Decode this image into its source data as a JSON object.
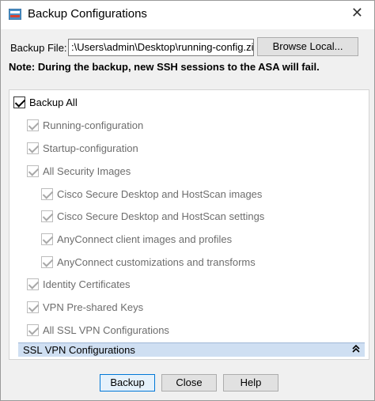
{
  "window": {
    "title": "Backup Configurations",
    "icon": "asa-app-icon",
    "close_symbol": "✕"
  },
  "file_row": {
    "label": "Backup File:",
    "value": ":\\Users\\admin\\Desktop\\running-config.zip",
    "browse_label": "Browse Local..."
  },
  "note": "Note: During the backup, new SSH sessions to the ASA will fail.",
  "backup_all": {
    "label": "Backup All",
    "checked": true
  },
  "items": [
    {
      "label": "Running-configuration",
      "checked": true,
      "enabled": false
    },
    {
      "label": "Startup-configuration",
      "checked": true,
      "enabled": false
    },
    {
      "label": "All Security Images",
      "checked": true,
      "enabled": false
    },
    {
      "label": "Cisco Secure Desktop and HostScan images",
      "checked": true,
      "enabled": false
    },
    {
      "label": "Cisco Secure Desktop and HostScan settings",
      "checked": true,
      "enabled": false
    },
    {
      "label": "AnyConnect client images and profiles",
      "checked": true,
      "enabled": false
    },
    {
      "label": "AnyConnect customizations and transforms",
      "checked": true,
      "enabled": false
    },
    {
      "label": "Identity Certificates",
      "checked": true,
      "enabled": false
    },
    {
      "label": "VPN Pre-shared Keys",
      "checked": true,
      "enabled": false
    },
    {
      "label": "All SSL VPN Configurations",
      "checked": true,
      "enabled": false
    }
  ],
  "section": {
    "label": "SSL VPN Configurations",
    "icon": "double-chevron-up-icon",
    "symbol": "⌃⌃"
  },
  "buttons": {
    "backup": "Backup",
    "close": "Close",
    "help": "Help"
  },
  "colors": {
    "section_bar": "#cfdff2",
    "default_button_border": "#0078d7"
  }
}
